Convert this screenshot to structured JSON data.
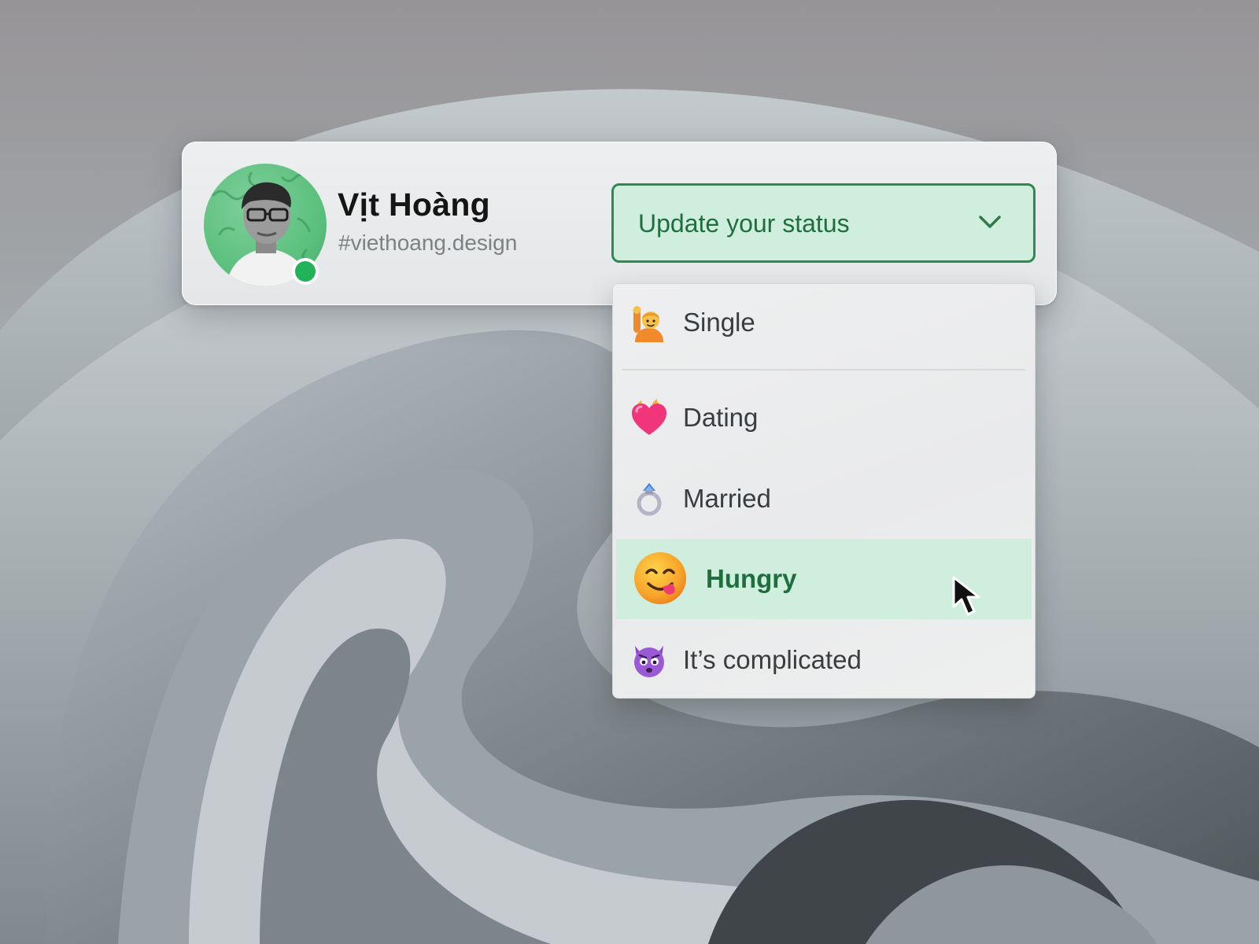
{
  "profile": {
    "name": "Vịt Hoàng",
    "handle": "#viethoang.design",
    "avatar_icon": "avatar",
    "presence": "online",
    "presence_color": "#22b35a"
  },
  "status_select": {
    "label": "Update your status",
    "icon": "chevron-down-icon",
    "fill_color": "#cfeedd",
    "accent_color": "#2f8a50"
  },
  "status_menu": {
    "items": [
      {
        "label": "Single",
        "icon": "person-raising-hand-icon"
      },
      {
        "label": "Dating",
        "icon": "heart-on-fire-icon"
      },
      {
        "label": "Married",
        "icon": "ring-icon"
      },
      {
        "label": "Hungry",
        "icon": "face-savoring-food-icon",
        "highlighted": true
      },
      {
        "label": "It’s complicated",
        "icon": "smiling-devil-icon"
      }
    ],
    "highlight_color": "#cfeedd"
  },
  "cursor": {
    "icon": "mouse-pointer-icon"
  }
}
